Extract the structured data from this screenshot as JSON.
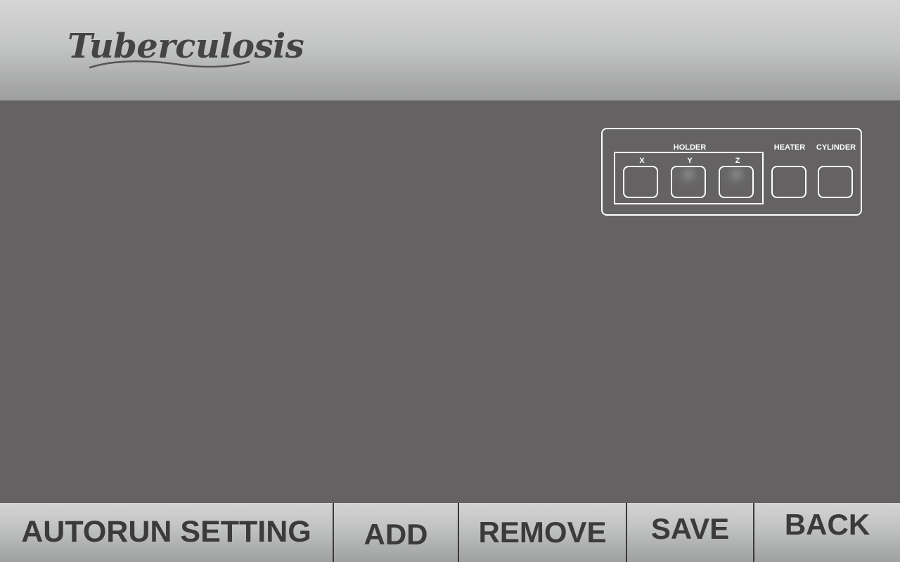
{
  "header": {
    "logo_text": "Tuberculosis"
  },
  "status_panel": {
    "holder_label": "HOLDER",
    "axes": [
      {
        "label": "X"
      },
      {
        "label": "Y"
      },
      {
        "label": "Z"
      }
    ],
    "heater_label": "HEATER",
    "cylinder_label": "CYLINDER"
  },
  "footer": {
    "title": "AUTORUN SETTING",
    "add_label": "ADD",
    "remove_label": "REMOVE",
    "save_label": "SAVE",
    "back_label": "BACK"
  },
  "colors": {
    "background": "#646263",
    "bar_top": "#d6d6d6",
    "bar_bottom": "#9d9e9e",
    "text_dark": "#3b3b3b",
    "indicator_border": "#ffffff"
  },
  "icons": {
    "logo_swoosh": "swoosh-underline-icon"
  }
}
